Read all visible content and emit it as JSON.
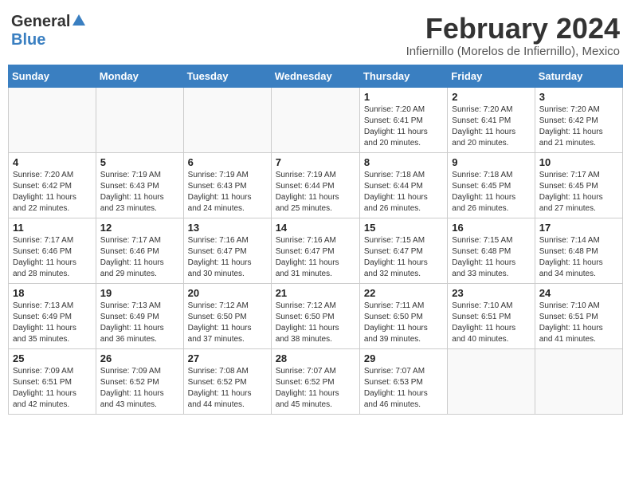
{
  "header": {
    "logo_general": "General",
    "logo_blue": "Blue",
    "month_title": "February 2024",
    "subtitle": "Infiernillo (Morelos de Infiernillo), Mexico"
  },
  "days_of_week": [
    "Sunday",
    "Monday",
    "Tuesday",
    "Wednesday",
    "Thursday",
    "Friday",
    "Saturday"
  ],
  "weeks": [
    [
      {
        "day": "",
        "info": ""
      },
      {
        "day": "",
        "info": ""
      },
      {
        "day": "",
        "info": ""
      },
      {
        "day": "",
        "info": ""
      },
      {
        "day": "1",
        "info": "Sunrise: 7:20 AM\nSunset: 6:41 PM\nDaylight: 11 hours\nand 20 minutes."
      },
      {
        "day": "2",
        "info": "Sunrise: 7:20 AM\nSunset: 6:41 PM\nDaylight: 11 hours\nand 20 minutes."
      },
      {
        "day": "3",
        "info": "Sunrise: 7:20 AM\nSunset: 6:42 PM\nDaylight: 11 hours\nand 21 minutes."
      }
    ],
    [
      {
        "day": "4",
        "info": "Sunrise: 7:20 AM\nSunset: 6:42 PM\nDaylight: 11 hours\nand 22 minutes."
      },
      {
        "day": "5",
        "info": "Sunrise: 7:19 AM\nSunset: 6:43 PM\nDaylight: 11 hours\nand 23 minutes."
      },
      {
        "day": "6",
        "info": "Sunrise: 7:19 AM\nSunset: 6:43 PM\nDaylight: 11 hours\nand 24 minutes."
      },
      {
        "day": "7",
        "info": "Sunrise: 7:19 AM\nSunset: 6:44 PM\nDaylight: 11 hours\nand 25 minutes."
      },
      {
        "day": "8",
        "info": "Sunrise: 7:18 AM\nSunset: 6:44 PM\nDaylight: 11 hours\nand 26 minutes."
      },
      {
        "day": "9",
        "info": "Sunrise: 7:18 AM\nSunset: 6:45 PM\nDaylight: 11 hours\nand 26 minutes."
      },
      {
        "day": "10",
        "info": "Sunrise: 7:17 AM\nSunset: 6:45 PM\nDaylight: 11 hours\nand 27 minutes."
      }
    ],
    [
      {
        "day": "11",
        "info": "Sunrise: 7:17 AM\nSunset: 6:46 PM\nDaylight: 11 hours\nand 28 minutes."
      },
      {
        "day": "12",
        "info": "Sunrise: 7:17 AM\nSunset: 6:46 PM\nDaylight: 11 hours\nand 29 minutes."
      },
      {
        "day": "13",
        "info": "Sunrise: 7:16 AM\nSunset: 6:47 PM\nDaylight: 11 hours\nand 30 minutes."
      },
      {
        "day": "14",
        "info": "Sunrise: 7:16 AM\nSunset: 6:47 PM\nDaylight: 11 hours\nand 31 minutes."
      },
      {
        "day": "15",
        "info": "Sunrise: 7:15 AM\nSunset: 6:47 PM\nDaylight: 11 hours\nand 32 minutes."
      },
      {
        "day": "16",
        "info": "Sunrise: 7:15 AM\nSunset: 6:48 PM\nDaylight: 11 hours\nand 33 minutes."
      },
      {
        "day": "17",
        "info": "Sunrise: 7:14 AM\nSunset: 6:48 PM\nDaylight: 11 hours\nand 34 minutes."
      }
    ],
    [
      {
        "day": "18",
        "info": "Sunrise: 7:13 AM\nSunset: 6:49 PM\nDaylight: 11 hours\nand 35 minutes."
      },
      {
        "day": "19",
        "info": "Sunrise: 7:13 AM\nSunset: 6:49 PM\nDaylight: 11 hours\nand 36 minutes."
      },
      {
        "day": "20",
        "info": "Sunrise: 7:12 AM\nSunset: 6:50 PM\nDaylight: 11 hours\nand 37 minutes."
      },
      {
        "day": "21",
        "info": "Sunrise: 7:12 AM\nSunset: 6:50 PM\nDaylight: 11 hours\nand 38 minutes."
      },
      {
        "day": "22",
        "info": "Sunrise: 7:11 AM\nSunset: 6:50 PM\nDaylight: 11 hours\nand 39 minutes."
      },
      {
        "day": "23",
        "info": "Sunrise: 7:10 AM\nSunset: 6:51 PM\nDaylight: 11 hours\nand 40 minutes."
      },
      {
        "day": "24",
        "info": "Sunrise: 7:10 AM\nSunset: 6:51 PM\nDaylight: 11 hours\nand 41 minutes."
      }
    ],
    [
      {
        "day": "25",
        "info": "Sunrise: 7:09 AM\nSunset: 6:51 PM\nDaylight: 11 hours\nand 42 minutes."
      },
      {
        "day": "26",
        "info": "Sunrise: 7:09 AM\nSunset: 6:52 PM\nDaylight: 11 hours\nand 43 minutes."
      },
      {
        "day": "27",
        "info": "Sunrise: 7:08 AM\nSunset: 6:52 PM\nDaylight: 11 hours\nand 44 minutes."
      },
      {
        "day": "28",
        "info": "Sunrise: 7:07 AM\nSunset: 6:52 PM\nDaylight: 11 hours\nand 45 minutes."
      },
      {
        "day": "29",
        "info": "Sunrise: 7:07 AM\nSunset: 6:53 PM\nDaylight: 11 hours\nand 46 minutes."
      },
      {
        "day": "",
        "info": ""
      },
      {
        "day": "",
        "info": ""
      }
    ]
  ]
}
